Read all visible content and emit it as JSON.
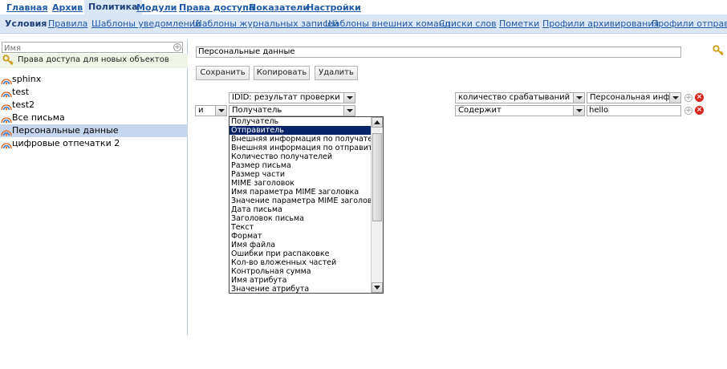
{
  "top_nav": {
    "items": [
      "Главная",
      "Архив",
      "Политика",
      "Модули",
      "Права доступа",
      "Показатели",
      "Настройки"
    ],
    "active": "Политика"
  },
  "sub_nav": {
    "items": [
      "Условия",
      "Правила",
      "Шаблоны уведомлений",
      "Шаблоны журнальных записей",
      "Шаблоны внешних команд",
      "Списки слов",
      "Пометки",
      "Профили архивирования",
      "Профили отправки"
    ],
    "active": "Условия"
  },
  "left_panel": {
    "search_placeholder": "Имя",
    "access_label": "Права доступа для новых объектов",
    "tree": [
      "sphinx",
      "test",
      "test2",
      "Все письма",
      "Персональные данные",
      "цифровые отпечатки 2"
    ],
    "selected": "Персональные данные"
  },
  "main": {
    "name_value": "Персональные данные",
    "buttons": {
      "save": "Сохранить",
      "copy": "Копировать",
      "delete": "Удалить"
    },
    "row1": {
      "field": "IDID: результат проверки",
      "operator": "количество срабатываний боль",
      "value": "Персональная информ"
    },
    "row2": {
      "logic": "и",
      "field": "Получатель",
      "operator": "Содержит",
      "value": "hello"
    }
  },
  "dropdown": {
    "options": [
      "Получатель",
      "Отправитель",
      "Внешняя информация по получателю",
      "Внешняя информация по отправителю",
      "Количество получателей",
      "Размер письма",
      "Размер части",
      "MIME заголовок",
      "Имя параметра MIME заголовка",
      "Значение параметра MIME заголовка",
      "Дата письма",
      "Заголовок письма",
      "Текст",
      "Формат",
      "Имя файла",
      "Ошибки при распаковке",
      "Кол-во вложенных частей",
      "Контрольная сумма",
      "Имя атрибута",
      "Значение атрибута"
    ],
    "highlighted": "Отправитель"
  },
  "colors": {
    "nav_link": "#1f5aa6",
    "subnav_bg": "#dbe6f5",
    "selected_row": "#c6d6ee",
    "highlight": "#0a246a",
    "delete_red": "#d9261c"
  },
  "icons": {
    "key": "key-icon",
    "policy": "policy-icon",
    "add": "plus-icon",
    "remove": "delete-icon"
  }
}
